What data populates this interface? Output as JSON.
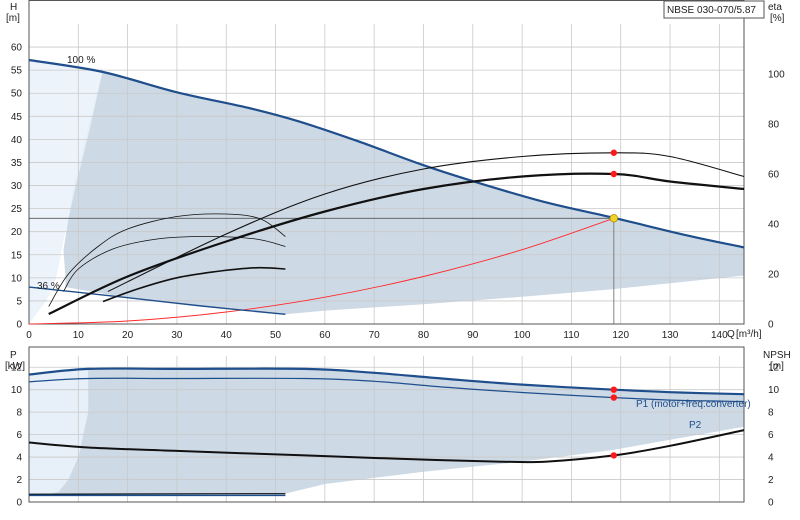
{
  "model_label": "NBSE 030-070/5.87",
  "chart_data": [
    {
      "type": "line",
      "name": "head-chart",
      "y_axis_title": "H",
      "y_axis_unit": "[m]",
      "y2_axis_title": "eta",
      "y2_axis_unit": "[%]",
      "x_axis_title": "Q",
      "x_axis_unit": "[m³/h]",
      "xlim": [
        0,
        145
      ],
      "x_ticks": [
        0,
        10,
        20,
        30,
        40,
        50,
        60,
        70,
        80,
        90,
        100,
        110,
        120,
        130,
        140
      ],
      "ylim": [
        0,
        65
      ],
      "y_ticks": [
        0,
        5,
        10,
        15,
        20,
        25,
        30,
        35,
        40,
        45,
        50,
        55,
        60
      ],
      "y2lim": [
        0,
        120
      ],
      "y2_ticks": [
        0,
        20,
        40,
        60,
        80,
        100
      ],
      "grid": true,
      "speed_labels": [
        "100 %",
        "36 %"
      ],
      "duty_point": {
        "x": 118.6,
        "y": 22.9
      },
      "head_curve_100": [
        [
          0,
          57.2
        ],
        [
          15,
          54.6
        ],
        [
          30,
          50.2
        ],
        [
          45,
          46.7
        ],
        [
          55,
          43.8
        ],
        [
          67,
          39.5
        ],
        [
          80,
          34.4
        ],
        [
          92,
          30.3
        ],
        [
          105,
          26.3
        ],
        [
          119,
          22.9
        ],
        [
          133,
          19.3
        ],
        [
          145,
          16.6
        ]
      ],
      "head_curve_36": [
        [
          0,
          8.0
        ],
        [
          20,
          5.7
        ],
        [
          35,
          3.9
        ],
        [
          52,
          2.1
        ]
      ],
      "operating_area": [
        [
          0,
          57.2
        ],
        [
          15,
          54.6
        ],
        [
          30,
          50.2
        ],
        [
          45,
          46.7
        ],
        [
          55,
          43.8
        ],
        [
          67,
          39.5
        ],
        [
          80,
          34.4
        ],
        [
          92,
          30.3
        ],
        [
          105,
          26.3
        ],
        [
          119,
          22.9
        ],
        [
          133,
          19.3
        ],
        [
          145,
          16.6
        ],
        [
          145,
          10.5
        ],
        [
          118,
          7.5
        ],
        [
          100,
          5.9
        ],
        [
          80,
          4.3
        ],
        [
          60,
          2.9
        ],
        [
          52,
          2.1
        ],
        [
          35,
          3.9
        ],
        [
          20,
          5.7
        ],
        [
          7.4,
          8.0
        ],
        [
          7.4,
          10.0
        ],
        [
          7.0,
          16.0
        ],
        [
          9.0,
          30.0
        ],
        [
          12.0,
          43.0
        ],
        [
          15.0,
          55.0
        ],
        [
          0,
          57.2
        ]
      ],
      "low_flow_region": [
        [
          0,
          57.2
        ],
        [
          15,
          55.2
        ],
        [
          12.5,
          43
        ],
        [
          9.5,
          30
        ],
        [
          7,
          18
        ],
        [
          5.5,
          10
        ],
        [
          3.5,
          5
        ],
        [
          0,
          0
        ]
      ],
      "system_curve": [
        [
          0,
          0
        ],
        [
          20,
          0.65
        ],
        [
          40,
          2.6
        ],
        [
          60,
          5.8
        ],
        [
          80,
          10.3
        ],
        [
          100,
          16.1
        ],
        [
          118.6,
          22.9
        ]
      ],
      "eta_total": [
        [
          16,
          13
        ],
        [
          40,
          36
        ],
        [
          60,
          52
        ],
        [
          80,
          62
        ],
        [
          100,
          67
        ],
        [
          118.6,
          68.5
        ],
        [
          130,
          67
        ],
        [
          145,
          59
        ]
      ],
      "eta_hydraulic": [
        [
          4,
          4
        ],
        [
          20,
          19
        ],
        [
          40,
          33
        ],
        [
          60,
          45
        ],
        [
          80,
          54
        ],
        [
          100,
          59
        ],
        [
          118.6,
          60
        ],
        [
          130,
          57
        ],
        [
          145,
          54
        ]
      ],
      "eta_part_load": [
        [
          [
            4,
            7
          ],
          [
            8,
            20
          ],
          [
            14,
            31
          ],
          [
            20,
            38
          ],
          [
            30,
            43
          ],
          [
            40,
            44
          ],
          [
            47,
            42
          ],
          [
            52,
            35
          ]
        ],
        [
          [
            7,
            13
          ],
          [
            10,
            22
          ],
          [
            17,
            30
          ],
          [
            26,
            34
          ],
          [
            36,
            35
          ],
          [
            46,
            34
          ],
          [
            52,
            31
          ]
        ],
        [
          [
            15,
            9
          ],
          [
            22,
            14
          ],
          [
            30,
            18.5
          ],
          [
            38,
            21
          ],
          [
            46,
            22.5
          ],
          [
            52,
            22
          ]
        ]
      ],
      "duty_markers_eta": [
        68.5,
        60
      ]
    },
    {
      "type": "line",
      "name": "power-chart",
      "y_axis_title": "P",
      "y_axis_unit": "[kW]",
      "y2_axis_title": "NPSH",
      "y2_axis_unit": "[m]",
      "xlim": [
        0,
        145
      ],
      "ylim": [
        0,
        13
      ],
      "y_ticks": [
        0,
        2,
        4,
        6,
        8,
        10,
        12
      ],
      "y2lim": [
        0,
        13
      ],
      "y2_ticks": [
        0,
        2,
        4,
        6,
        8,
        10,
        12
      ],
      "grid": true,
      "series_labels": [
        "P1 (motor+freq.converter)",
        "P2"
      ],
      "p1": [
        [
          0,
          11.35
        ],
        [
          12,
          11.85
        ],
        [
          30,
          11.85
        ],
        [
          56,
          11.85
        ],
        [
          70,
          11.5
        ],
        [
          85,
          10.95
        ],
        [
          100,
          10.45
        ],
        [
          118.6,
          10.0
        ],
        [
          132,
          9.75
        ],
        [
          145,
          9.6
        ]
      ],
      "p2": [
        [
          0,
          10.7
        ],
        [
          12,
          11.0
        ],
        [
          30,
          11.0
        ],
        [
          56,
          11.0
        ],
        [
          70,
          10.75
        ],
        [
          85,
          10.2
        ],
        [
          100,
          9.75
        ],
        [
          118.6,
          9.3
        ],
        [
          132,
          9.05
        ],
        [
          145,
          8.95
        ]
      ],
      "npsh": [
        [
          0,
          5.3
        ],
        [
          12,
          4.85
        ],
        [
          30,
          4.55
        ],
        [
          56,
          4.15
        ],
        [
          75,
          3.85
        ],
        [
          95,
          3.6
        ],
        [
          105,
          3.6
        ],
        [
          118.6,
          4.15
        ],
        [
          130,
          5.0
        ],
        [
          145,
          6.4
        ]
      ],
      "p_low_speed": [
        [
          0,
          0.6
        ],
        [
          52,
          0.6
        ]
      ],
      "p_low_speed_2": [
        [
          0,
          0.7
        ],
        [
          52,
          0.75
        ]
      ],
      "area": [
        [
          0,
          11.35
        ],
        [
          12,
          11.85
        ],
        [
          56,
          11.85
        ],
        [
          70,
          11.5
        ],
        [
          85,
          10.95
        ],
        [
          100,
          10.45
        ],
        [
          118.6,
          10.0
        ],
        [
          132,
          9.75
        ],
        [
          145,
          9.6
        ],
        [
          145,
          6.7
        ],
        [
          118,
          4.6
        ],
        [
          100,
          3.6
        ],
        [
          80,
          2.7
        ],
        [
          60,
          1.6
        ],
        [
          52,
          0.75
        ],
        [
          12,
          0.65
        ],
        [
          7,
          0.6
        ],
        [
          0,
          0.6
        ],
        [
          0,
          11.35
        ]
      ],
      "low_flow_region": [
        [
          0,
          11.35
        ],
        [
          12,
          11.85
        ],
        [
          12,
          8
        ],
        [
          10,
          4
        ],
        [
          8,
          2
        ],
        [
          6,
          0.9
        ],
        [
          3,
          0.6
        ],
        [
          0,
          0.6
        ]
      ],
      "duty_markers": [
        10.0,
        9.3,
        4.15
      ],
      "duty_x": 118.6
    }
  ],
  "colors": {
    "area": "#cdd9e5",
    "low_flow": "#eaf2fa",
    "main_curve": "#1f4e8c",
    "eta_curve": "#111111",
    "system_curve": "#ff2a2a",
    "duty_point_fill": "#f1d42a",
    "duty_marker": "#ff1a1a",
    "grid": "#c9c9c9",
    "axis_text": "#222222"
  }
}
